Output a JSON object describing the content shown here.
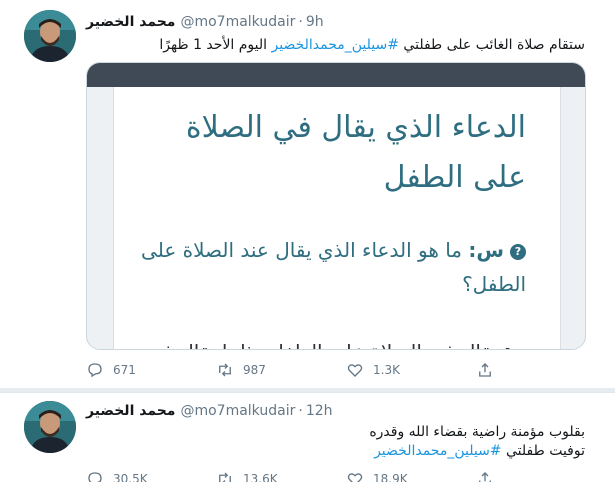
{
  "tweets": [
    {
      "author_name": "محمد الخضير",
      "handle": "@mo7malkudair",
      "separator": "·",
      "time": "9h",
      "text_before": "ستقام صلاة الغائب على طفلتي ",
      "hashtag": "#سيلين_محمدالخضير",
      "text_after": " اليوم الأحد 1 ظهرًا",
      "media": {
        "heading": "الدعاء الذي يقال في الصلاة على الطفل",
        "question_prefix": "س:",
        "question": "ما هو الدعاء الذي يقال عند الصلاة على الطفل؟",
        "answer_prefix": "ج:",
        "answer": "يقال في الصلاة على الطفل مثلما يقال في"
      },
      "actions": {
        "replies": "671",
        "retweets": "987",
        "likes": "1.3K"
      }
    },
    {
      "author_name": "محمد الخضير",
      "handle": "@mo7malkudair",
      "separator": "·",
      "time": "12h",
      "line1": "بقلوب مؤمنة راضية بقضاء الله وقدره",
      "line2_before": "توفيت طفلتي ",
      "hashtag": "#سيلين_محمدالخضير",
      "actions": {
        "replies": "30.5K",
        "retweets": "13.6K",
        "likes": "18.9K"
      }
    }
  ],
  "colors": {
    "hashtag": "#1b95e0",
    "muted": "#657786",
    "card_text": "#2e6e80"
  },
  "icons": [
    "reply-icon",
    "retweet-icon",
    "like-icon",
    "share-icon"
  ]
}
